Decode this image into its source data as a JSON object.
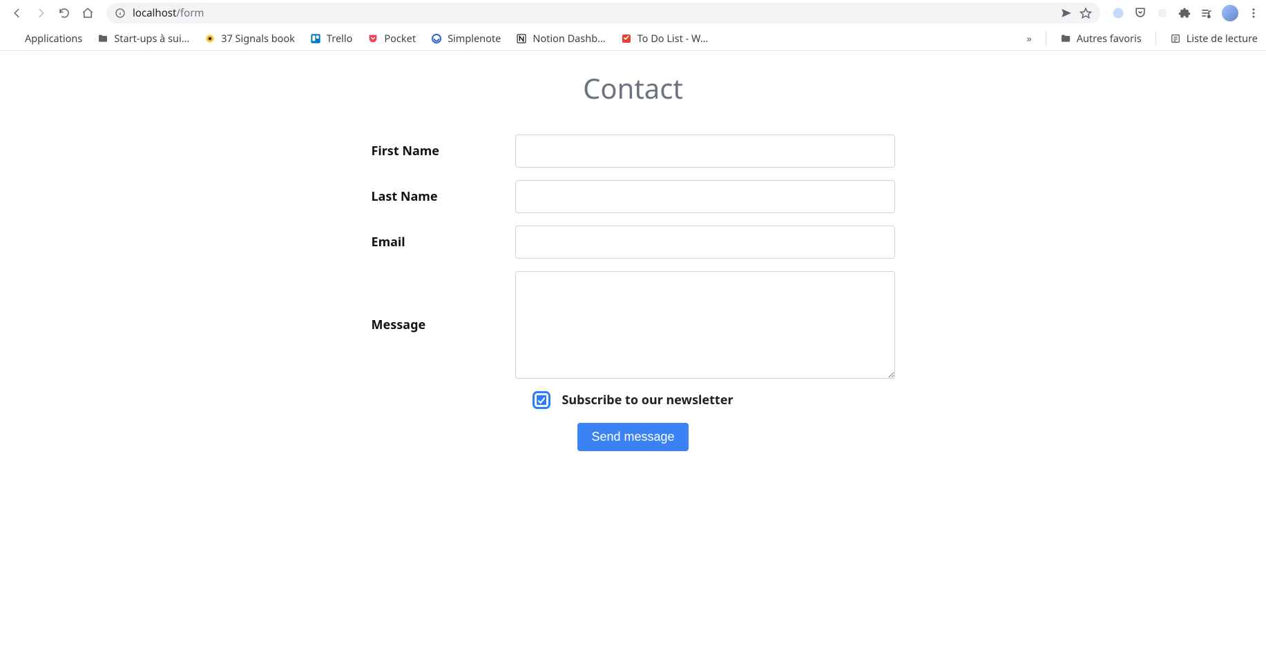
{
  "browser": {
    "url_host": "localhost",
    "url_path": "/form"
  },
  "bookmarks": {
    "items": [
      {
        "label": "Applications"
      },
      {
        "label": "Start-ups à sui…"
      },
      {
        "label": "37 Signals book"
      },
      {
        "label": "Trello"
      },
      {
        "label": "Pocket"
      },
      {
        "label": "Simplenote"
      },
      {
        "label": "Notion Dashb…"
      },
      {
        "label": "To Do List - W…"
      }
    ],
    "overflow": "»",
    "right": [
      {
        "label": "Autres favoris"
      },
      {
        "label": "Liste de lecture"
      }
    ]
  },
  "page": {
    "title": "Contact",
    "fields": {
      "first_name": {
        "label": "First Name",
        "value": ""
      },
      "last_name": {
        "label": "Last Name",
        "value": ""
      },
      "email": {
        "label": "Email",
        "value": ""
      },
      "message": {
        "label": "Message",
        "value": ""
      }
    },
    "newsletter": {
      "label": "Subscribe to our newsletter",
      "checked": true
    },
    "submit_label": "Send message"
  }
}
